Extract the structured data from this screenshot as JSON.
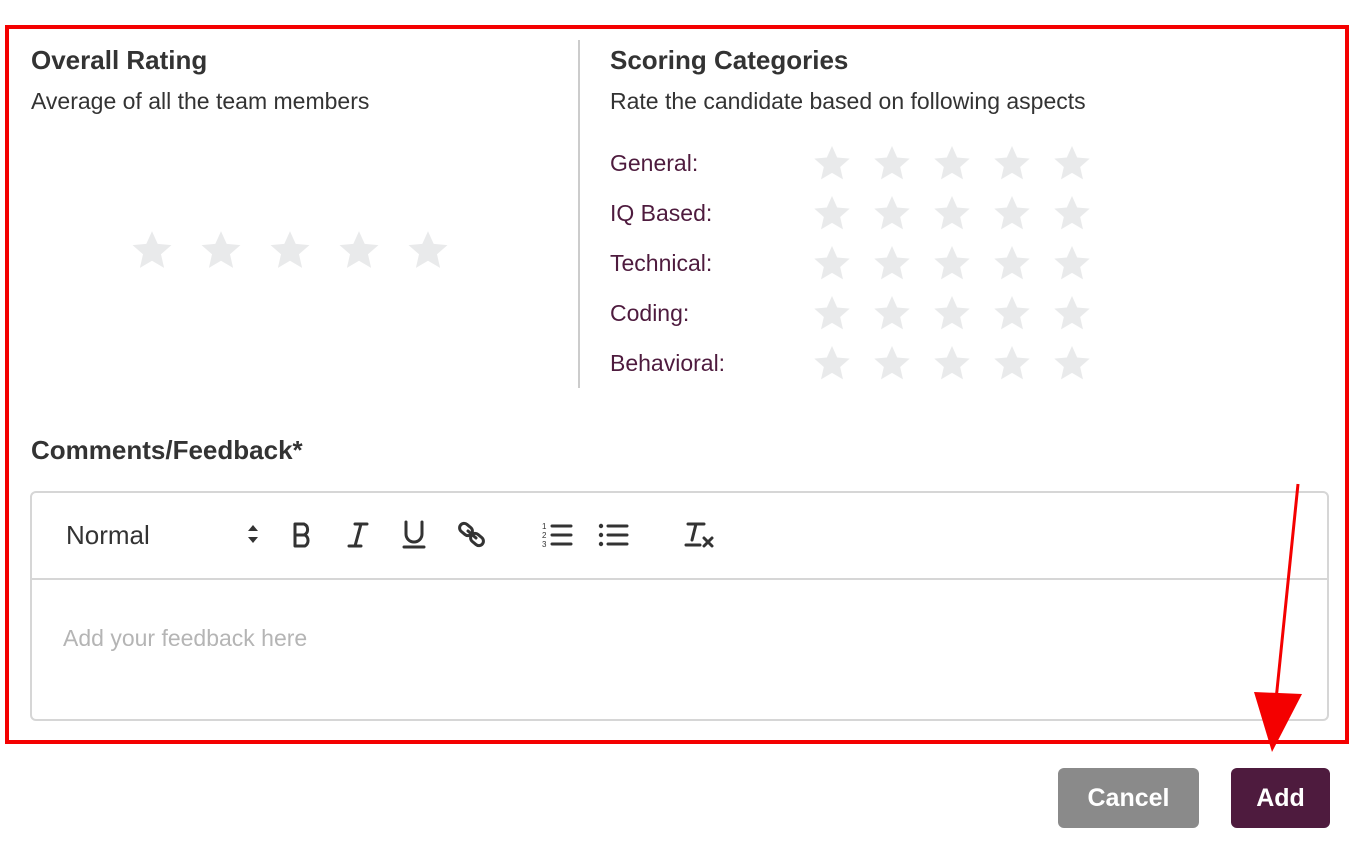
{
  "overall": {
    "title": "Overall Rating",
    "subtitle": "Average of all the team members",
    "rating": 0,
    "max_rating": 5
  },
  "scoring": {
    "title": "Scoring Categories",
    "subtitle": "Rate the candidate based on following aspects",
    "categories": [
      {
        "label": "General:",
        "rating": 0
      },
      {
        "label": "IQ Based:",
        "rating": 0
      },
      {
        "label": "Technical:",
        "rating": 0
      },
      {
        "label": "Coding:",
        "rating": 0
      },
      {
        "label": "Behavioral:",
        "rating": 0
      }
    ],
    "max_rating": 5
  },
  "comments": {
    "label": "Comments/Feedback*",
    "placeholder": "Add your feedback here",
    "format_value": "Normal",
    "toolbar_icons": [
      "bold-icon",
      "italic-icon",
      "underline-icon",
      "link-icon",
      "ordered-list-icon",
      "bullet-list-icon",
      "clear-format-icon"
    ]
  },
  "actions": {
    "cancel_label": "Cancel",
    "add_label": "Add"
  },
  "colors": {
    "annotation_red": "#f40000",
    "accent": "#4e1b3e",
    "cancel_bg": "#8a8a8a",
    "star_empty": "#e9eaeb"
  }
}
